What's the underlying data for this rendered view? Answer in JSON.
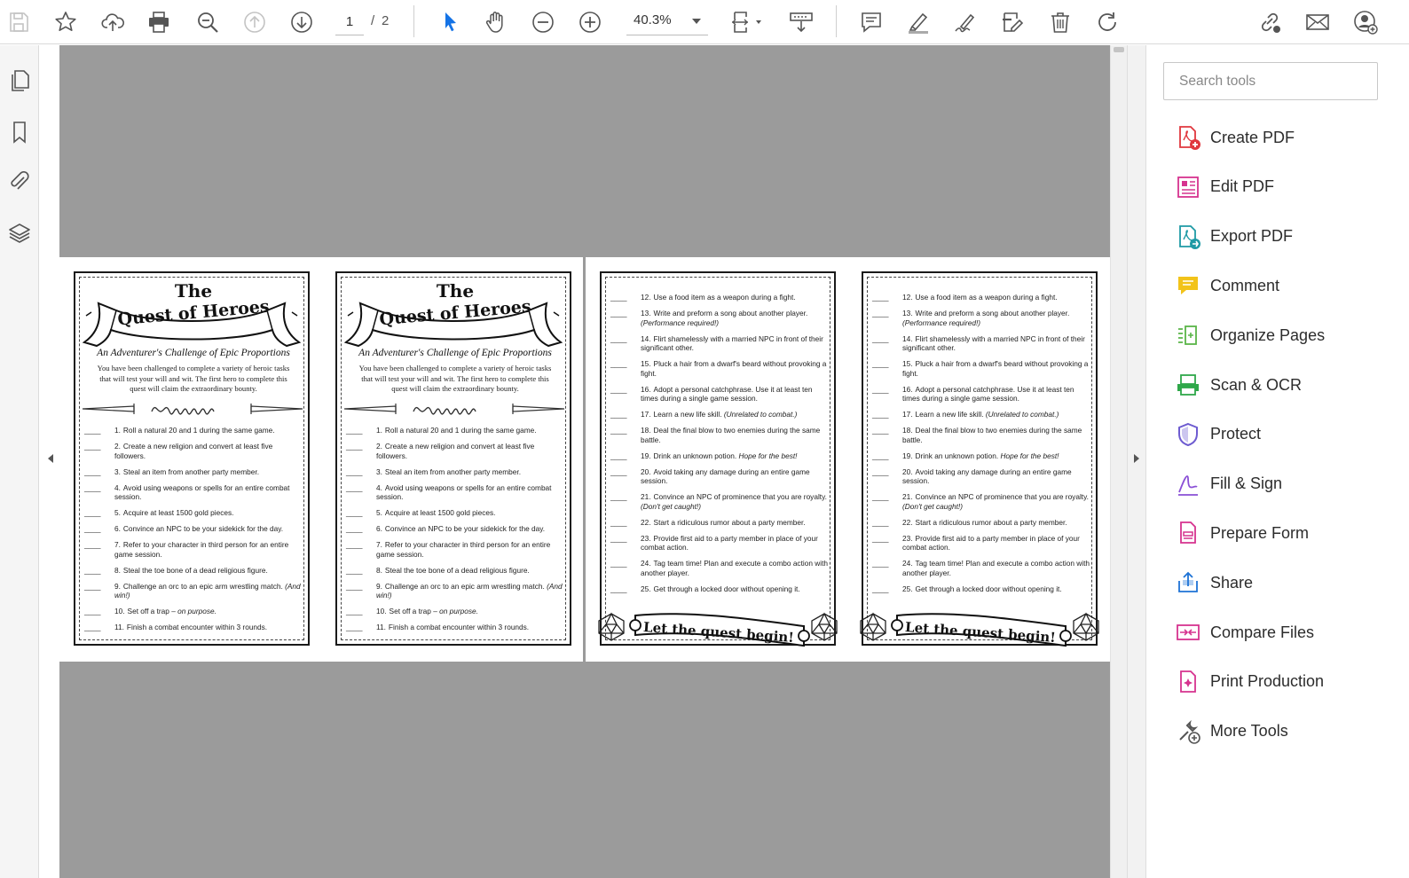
{
  "toolbar": {
    "page_current": "1",
    "page_separator": "/",
    "page_total": "2",
    "zoom": "40.3%",
    "icons": [
      "save-icon",
      "star-icon",
      "cloud-upload-icon",
      "print-icon",
      "zoom-marquee-icon",
      "previous-page-icon",
      "next-page-icon",
      "select-cursor-icon",
      "hand-icon",
      "zoom-out-icon",
      "zoom-in-icon",
      "page-display-icon",
      "scroll-mode-icon",
      "comment-icon",
      "highlight-icon",
      "sign-icon",
      "edit-text-icon",
      "delete-icon",
      "rotate-icon",
      "link-share-icon",
      "mail-icon",
      "add-user-icon"
    ]
  },
  "left_rail": {
    "icons": [
      "page-thumbnails-icon",
      "bookmarks-icon",
      "attachments-icon",
      "layers-icon"
    ]
  },
  "document": {
    "card_front": {
      "the": "The",
      "title": "Quest of Heroes",
      "subtitle": "An Adventurer's Challenge of Epic Proportions",
      "intro": "You have been challenged to complete a variety of heroic tasks that will test your will and wit. The first hero to complete this quest will claim the extraordinary bounty.",
      "tasks": [
        {
          "num": "1.",
          "text": "Roll a natural 20 and 1 during the same game.",
          "note": ""
        },
        {
          "num": "2.",
          "text": "Create a new religion and convert at least five followers.",
          "note": ""
        },
        {
          "num": "3.",
          "text": "Steal an item from another party member.",
          "note": ""
        },
        {
          "num": "4.",
          "text": "Avoid using weapons or spells for an entire combat session.",
          "note": ""
        },
        {
          "num": "5.",
          "text": "Acquire at least 1500 gold pieces.",
          "note": ""
        },
        {
          "num": "6.",
          "text": "Convince an NPC to be your sidekick for the day.",
          "note": ""
        },
        {
          "num": "7.",
          "text": "Refer to your character in third person for an entire game session.",
          "note": ""
        },
        {
          "num": "8.",
          "text": "Steal the toe bone of a dead religious figure.",
          "note": ""
        },
        {
          "num": "9.",
          "text": "Challenge an orc to an epic arm wrestling match.",
          "note": "(And win!)"
        },
        {
          "num": "10.",
          "text": "Set off a trap –",
          "note": "on purpose."
        },
        {
          "num": "11.",
          "text": "Finish a combat encounter within 3 rounds.",
          "note": ""
        }
      ]
    },
    "card_back": {
      "tasks": [
        {
          "num": "12.",
          "text": "Use a food item as a weapon during a fight.",
          "note": ""
        },
        {
          "num": "13.",
          "text": "Write and preform a song about another player.",
          "note": "(Performance required!)"
        },
        {
          "num": "14.",
          "text": "Flirt  shamelessly with a married NPC in front of their significant other.",
          "note": ""
        },
        {
          "num": "15.",
          "text": "Pluck a hair from a dwarf's beard without provoking a fight.",
          "note": ""
        },
        {
          "num": "16.",
          "text": "Adopt a personal catchphrase. Use it at least ten times during a single game session.",
          "note": ""
        },
        {
          "num": "17.",
          "text": "Learn a new life skill.",
          "note": "(Unrelated to combat.)"
        },
        {
          "num": "18.",
          "text": "Deal the final blow to two enemies during the same battle.",
          "note": ""
        },
        {
          "num": "19.",
          "text": "Drink an unknown potion.",
          "note": "Hope for the best!"
        },
        {
          "num": "20.",
          "text": "Avoid taking any damage during an entire game session.",
          "note": ""
        },
        {
          "num": "21.",
          "text": "Convince an NPC of prominence that you are royalty.",
          "note": "(Don't get caught!)"
        },
        {
          "num": "22.",
          "text": "Start a ridiculous rumor about a party member.",
          "note": ""
        },
        {
          "num": "23.",
          "text": "Provide first aid to a party member in place of your combat action.",
          "note": ""
        },
        {
          "num": "24.",
          "text": "Tag team time! Plan and execute a combo action with another player.",
          "note": ""
        },
        {
          "num": "25.",
          "text": "Get through a locked door without opening it.",
          "note": ""
        }
      ],
      "closing": "Let the quest begin!"
    }
  },
  "tools_panel": {
    "search_placeholder": "Search tools",
    "tools": [
      {
        "label": "Create PDF",
        "icon": "create-pdf-icon",
        "color": "#e0373e"
      },
      {
        "label": "Edit PDF",
        "icon": "edit-pdf-icon",
        "color": "#d6338f"
      },
      {
        "label": "Export PDF",
        "icon": "export-pdf-icon",
        "color": "#1e9aa5"
      },
      {
        "label": "Comment",
        "icon": "comment-icon",
        "color": "#f2c31a"
      },
      {
        "label": "Organize Pages",
        "icon": "organize-pages-icon",
        "color": "#5ab548"
      },
      {
        "label": "Scan & OCR",
        "icon": "scan-ocr-icon",
        "color": "#2fa84a"
      },
      {
        "label": "Protect",
        "icon": "protect-icon",
        "color": "#6d5bd0"
      },
      {
        "label": "Fill & Sign",
        "icon": "fill-sign-icon",
        "color": "#8a4fd6"
      },
      {
        "label": "Prepare Form",
        "icon": "prepare-form-icon",
        "color": "#d6338f"
      },
      {
        "label": "Share",
        "icon": "share-icon",
        "color": "#1e73d6"
      },
      {
        "label": "Compare Files",
        "icon": "compare-files-icon",
        "color": "#d6338f"
      },
      {
        "label": "Print Production",
        "icon": "print-production-icon",
        "color": "#d6338f"
      },
      {
        "label": "More Tools",
        "icon": "more-tools-icon",
        "color": "#555555"
      }
    ]
  },
  "colors": {
    "accent_blue": "#1473e6",
    "canvas_gray": "#9b9b9b"
  }
}
